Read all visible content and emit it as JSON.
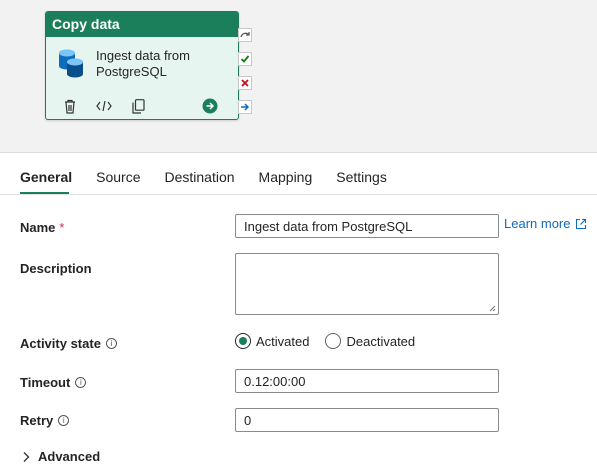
{
  "activity": {
    "type_label": "Copy data",
    "name": "Ingest data from PostgreSQL",
    "icon": "database-icon",
    "actions": [
      "delete-icon",
      "code-icon",
      "copy-icon",
      "run-arrow-icon"
    ]
  },
  "side_connectors": [
    "skip-arrow-icon",
    "success-check-icon",
    "fail-x-icon",
    "completion-arrow-icon"
  ],
  "tabs": [
    {
      "label": "General",
      "active": true
    },
    {
      "label": "Source",
      "active": false
    },
    {
      "label": "Destination",
      "active": false
    },
    {
      "label": "Mapping",
      "active": false
    },
    {
      "label": "Settings",
      "active": false
    }
  ],
  "form": {
    "name_label": "Name",
    "name_required": "*",
    "name_value": "Ingest data from PostgreSQL",
    "learn_more": "Learn more",
    "description_label": "Description",
    "description_value": "",
    "activity_state_label": "Activity state",
    "activated_label": "Activated",
    "deactivated_label": "Deactivated",
    "activity_state_selected": "Activated",
    "timeout_label": "Timeout",
    "timeout_value": "0.12:00:00",
    "retry_label": "Retry",
    "retry_value": "0",
    "advanced_label": "Advanced"
  },
  "colors": {
    "accent": "#1a7f5a",
    "card_bg": "#e6f5ef",
    "link": "#0f6cbd",
    "required": "#c4314b"
  }
}
